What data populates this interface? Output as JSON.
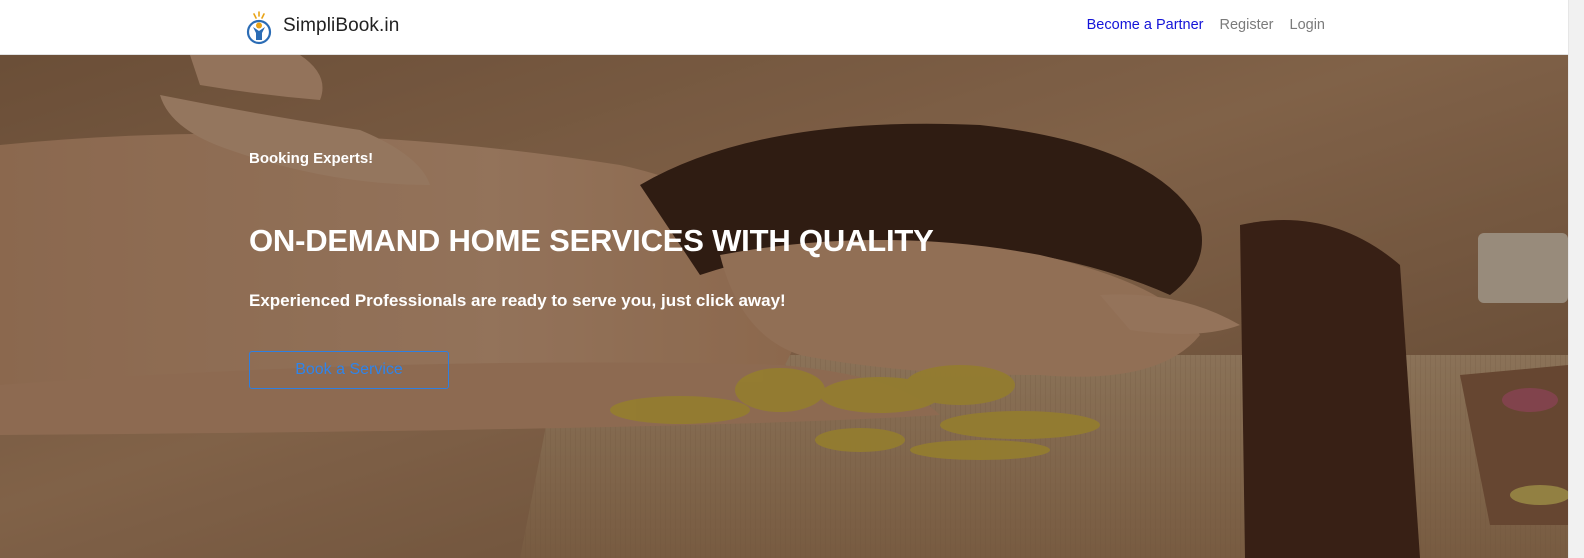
{
  "header": {
    "brand_name": "SimpliBook.in",
    "logo_icon": "person-badge-icon",
    "nav": [
      {
        "label": "Become a Partner",
        "color": "#1414d8"
      },
      {
        "label": "Register",
        "color": "#7b7b7b"
      },
      {
        "label": "Login",
        "color": "#7b7b7b"
      }
    ]
  },
  "hero": {
    "eyebrow": "Booking Experts!",
    "headline": "ON-DEMAND HOME SERVICES WITH QUALITY",
    "subheadline": "Experienced Professionals are ready to serve you, just click away!",
    "cta_label": "Book a Service",
    "cta_color": "#2f84ea",
    "background": "spa-massage-photo"
  }
}
